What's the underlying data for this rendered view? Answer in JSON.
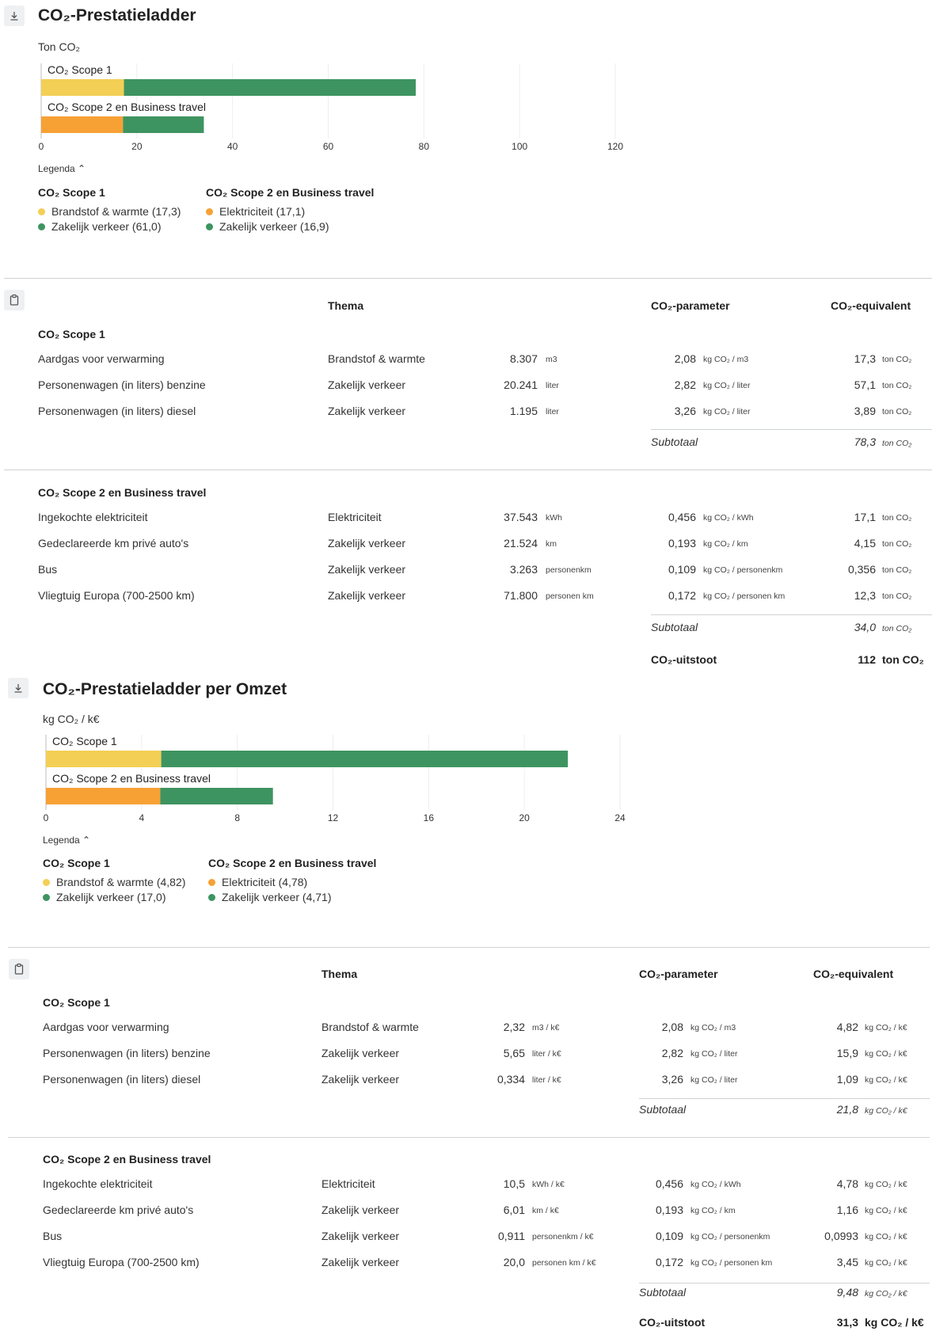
{
  "colors": {
    "yellow": "#f3cf55",
    "orange": "#f7a135",
    "green": "#3e9460"
  },
  "chart_data": [
    {
      "type": "bar",
      "orientation": "horizontal",
      "stacked": true,
      "title": "CO₂-Prestatieladder",
      "unit_label": "Ton CO₂",
      "categories": [
        "CO₂ Scope 1",
        "CO₂ Scope 2 en Business travel"
      ],
      "series": [
        {
          "name": "Brandstof & warmte",
          "values": [
            17.3,
            0
          ]
        },
        {
          "name": "Elektriciteit",
          "values": [
            0,
            17.1
          ]
        },
        {
          "name": "Zakelijk verkeer",
          "values": [
            61.0,
            16.9
          ]
        }
      ],
      "xlim": [
        0,
        120
      ],
      "xticks": [
        0,
        20,
        40,
        60,
        80,
        100,
        120
      ],
      "grid": true,
      "legend_placement": "bottom"
    },
    {
      "type": "bar",
      "orientation": "horizontal",
      "stacked": true,
      "title": "CO₂-Prestatieladder per Omzet",
      "unit_label": "kg CO₂ / k€",
      "categories": [
        "CO₂ Scope 1",
        "CO₂ Scope 2 en Business travel"
      ],
      "series": [
        {
          "name": "Brandstof & warmte",
          "values": [
            4.82,
            0
          ]
        },
        {
          "name": "Elektriciteit",
          "values": [
            0,
            4.78
          ]
        },
        {
          "name": "Zakelijk verkeer",
          "values": [
            17.0,
            4.71
          ]
        }
      ],
      "xlim": [
        0,
        24
      ],
      "xticks": [
        0,
        4,
        8,
        12,
        16,
        20,
        24
      ],
      "grid": true,
      "legend_placement": "bottom"
    }
  ],
  "section1": {
    "title": "CO₂-Prestatieladder",
    "unit": "Ton CO₂",
    "legend_toggle": "Legenda ⌃",
    "legend": {
      "g1": {
        "head": "CO₂ Scope 1",
        "items": [
          "Brandstof & warmte (17,3)",
          "Zakelijk verkeer (61,0)"
        ]
      },
      "g2": {
        "head": "CO₂ Scope 2 en Business travel",
        "items": [
          "Elektriciteit (17,1)",
          "Zakelijk verkeer (16,9)"
        ]
      }
    },
    "table": {
      "headers": {
        "thema": "Thema",
        "param": "CO₂-parameter",
        "equiv": "CO₂-equivalent"
      },
      "scope1_head": "CO₂ Scope 1",
      "scope1_rows": [
        {
          "name": "Aardgas voor verwarming",
          "thema": "Brandstof & warmte",
          "qty": "8.307",
          "qty_u": "m3",
          "param": "2,08",
          "param_u": "kg CO₂ / m3",
          "eq": "17,3",
          "eq_u": "ton CO₂"
        },
        {
          "name": "Personenwagen (in liters) benzine",
          "thema": "Zakelijk verkeer",
          "qty": "20.241",
          "qty_u": "liter",
          "param": "2,82",
          "param_u": "kg CO₂ / liter",
          "eq": "57,1",
          "eq_u": "ton CO₂"
        },
        {
          "name": "Personenwagen (in liters) diesel",
          "thema": "Zakelijk verkeer",
          "qty": "1.195",
          "qty_u": "liter",
          "param": "3,26",
          "param_u": "kg CO₂ / liter",
          "eq": "3,89",
          "eq_u": "ton CO₂"
        }
      ],
      "scope1_subtotal": {
        "label": "Subtotaal",
        "value": "78,3",
        "unit": "ton CO₂"
      },
      "scope2_head": "CO₂ Scope 2 en Business travel",
      "scope2_rows": [
        {
          "name": "Ingekochte elektriciteit",
          "thema": "Elektriciteit",
          "qty": "37.543",
          "qty_u": "kWh",
          "param": "0,456",
          "param_u": "kg CO₂ / kWh",
          "eq": "17,1",
          "eq_u": "ton CO₂"
        },
        {
          "name": "Gedeclareerde km privé auto's",
          "thema": "Zakelijk verkeer",
          "qty": "21.524",
          "qty_u": "km",
          "param": "0,193",
          "param_u": "kg CO₂ / km",
          "eq": "4,15",
          "eq_u": "ton CO₂"
        },
        {
          "name": "Bus",
          "thema": "Zakelijk verkeer",
          "qty": "3.263",
          "qty_u": "personenkm",
          "param": "0,109",
          "param_u": "kg CO₂ / personenkm",
          "eq": "0,356",
          "eq_u": "ton CO₂"
        },
        {
          "name": "Vliegtuig Europa (700-2500 km)",
          "thema": "Zakelijk verkeer",
          "qty": "71.800",
          "qty_u": "personen km",
          "param": "0,172",
          "param_u": "kg CO₂ / personen km",
          "eq": "12,3",
          "eq_u": "ton CO₂"
        }
      ],
      "scope2_subtotal": {
        "label": "Subtotaal",
        "value": "34,0",
        "unit": "ton CO₂"
      },
      "total": {
        "label": "CO₂-uitstoot",
        "value": "112",
        "unit": "ton CO₂"
      }
    }
  },
  "section2": {
    "title": "CO₂-Prestatieladder per Omzet",
    "unit": "kg CO₂ / k€",
    "legend_toggle": "Legenda ⌃",
    "legend": {
      "g1": {
        "head": "CO₂ Scope 1",
        "items": [
          "Brandstof & warmte (4,82)",
          "Zakelijk verkeer (17,0)"
        ]
      },
      "g2": {
        "head": "CO₂ Scope 2 en Business travel",
        "items": [
          "Elektriciteit (4,78)",
          "Zakelijk verkeer (4,71)"
        ]
      }
    },
    "table": {
      "headers": {
        "thema": "Thema",
        "param": "CO₂-parameter",
        "equiv": "CO₂-equivalent"
      },
      "scope1_head": "CO₂ Scope 1",
      "scope1_rows": [
        {
          "name": "Aardgas voor verwarming",
          "thema": "Brandstof & warmte",
          "qty": "2,32",
          "qty_u": "m3 / k€",
          "param": "2,08",
          "param_u": "kg CO₂ / m3",
          "eq": "4,82",
          "eq_u": "kg CO₂ / k€"
        },
        {
          "name": "Personenwagen (in liters) benzine",
          "thema": "Zakelijk verkeer",
          "qty": "5,65",
          "qty_u": "liter / k€",
          "param": "2,82",
          "param_u": "kg CO₂ / liter",
          "eq": "15,9",
          "eq_u": "kg CO₂ / k€"
        },
        {
          "name": "Personenwagen (in liters) diesel",
          "thema": "Zakelijk verkeer",
          "qty": "0,334",
          "qty_u": "liter / k€",
          "param": "3,26",
          "param_u": "kg CO₂ / liter",
          "eq": "1,09",
          "eq_u": "kg CO₂ / k€"
        }
      ],
      "scope1_subtotal": {
        "label": "Subtotaal",
        "value": "21,8",
        "unit": "kg CO₂ / k€"
      },
      "scope2_head": "CO₂ Scope 2 en Business travel",
      "scope2_rows": [
        {
          "name": "Ingekochte elektriciteit",
          "thema": "Elektriciteit",
          "qty": "10,5",
          "qty_u": "kWh / k€",
          "param": "0,456",
          "param_u": "kg CO₂ / kWh",
          "eq": "4,78",
          "eq_u": "kg CO₂ / k€"
        },
        {
          "name": "Gedeclareerde km privé auto's",
          "thema": "Zakelijk verkeer",
          "qty": "6,01",
          "qty_u": "km / k€",
          "param": "0,193",
          "param_u": "kg CO₂ / km",
          "eq": "1,16",
          "eq_u": "kg CO₂ / k€"
        },
        {
          "name": "Bus",
          "thema": "Zakelijk verkeer",
          "qty": "0,911",
          "qty_u": "personenkm / k€",
          "param": "0,109",
          "param_u": "kg CO₂ / personenkm",
          "eq": "0,0993",
          "eq_u": "kg CO₂ / k€"
        },
        {
          "name": "Vliegtuig Europa (700-2500 km)",
          "thema": "Zakelijk verkeer",
          "qty": "20,0",
          "qty_u": "personen km / k€",
          "param": "0,172",
          "param_u": "kg CO₂ / personen km",
          "eq": "3,45",
          "eq_u": "kg CO₂ / k€"
        }
      ],
      "scope2_subtotal": {
        "label": "Subtotaal",
        "value": "9,48",
        "unit": "kg CO₂ / k€"
      },
      "total": {
        "label": "CO₂-uitstoot",
        "value": "31,3",
        "unit": "kg CO₂ / k€"
      }
    }
  }
}
